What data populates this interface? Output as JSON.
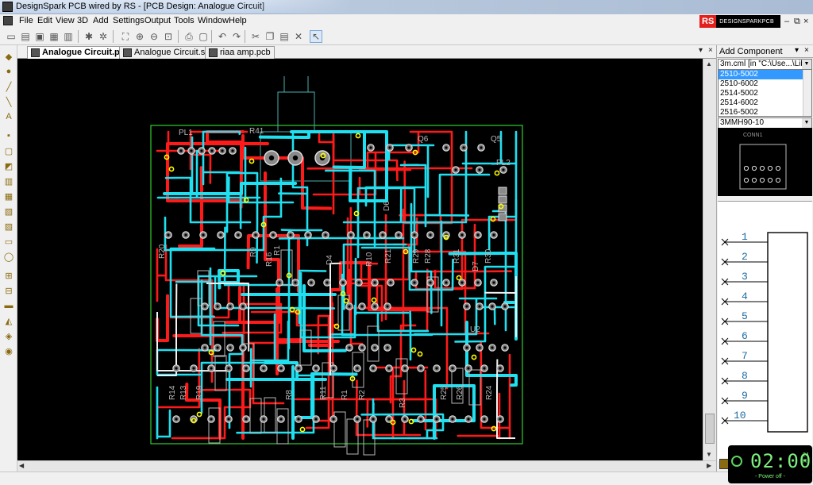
{
  "window": {
    "title": "DesignSpark PCB wired by RS - [PCB Design: Analogue Circuit]"
  },
  "menu": [
    "File",
    "Edit",
    "View",
    "3D",
    "Add",
    "Settings",
    "Output",
    "Tools",
    "Window",
    "Help"
  ],
  "brand": {
    "rs": "RS",
    "name": "DESIGNSPARKPCB"
  },
  "tabs": [
    {
      "label": "Analogue Circuit.pcb",
      "active": true
    },
    {
      "label": "Analogue Circuit.sch",
      "active": false
    },
    {
      "label": "riaa amp.pcb",
      "active": false
    }
  ],
  "pcb_labels": {
    "silk": [
      "PL1",
      "R41",
      "Q6",
      "Q5",
      "PL2",
      "R20",
      "R9",
      "R16",
      "R1",
      "D4",
      "R10",
      "R21",
      "R29",
      "R28",
      "R31",
      "D7",
      "R30",
      "U2",
      "R14",
      "R13",
      "R19",
      "R8",
      "R11",
      "R1",
      "R2",
      "R3",
      "R25",
      "R26",
      "R24",
      "D6"
    ]
  },
  "panel": {
    "title": "Add Component",
    "library_combo": "3m.cml   [in \"C:\\Use...\\Libr",
    "components": [
      "2510-5002",
      "2510-6002",
      "2514-5002",
      "2514-6002",
      "2516-5002"
    ],
    "selected_component": "2510-5002",
    "footprint_combo": "3MMH90-10",
    "preview_label": "CONN1",
    "pin_numbers": [
      "1",
      "2",
      "3",
      "4",
      "5",
      "6",
      "7",
      "8",
      "9",
      "10"
    ]
  },
  "clock": {
    "time": "02:00",
    "ampm_top": "24",
    "ampm_bottom": "H",
    "status": "- Power off -"
  },
  "colors": {
    "copper_top": "#ff1a1a",
    "copper_bottom": "#1fe0f0",
    "board_outline": "#2fcf2f",
    "silkscreen": "#b8b8b8",
    "via": "#ffff00"
  }
}
